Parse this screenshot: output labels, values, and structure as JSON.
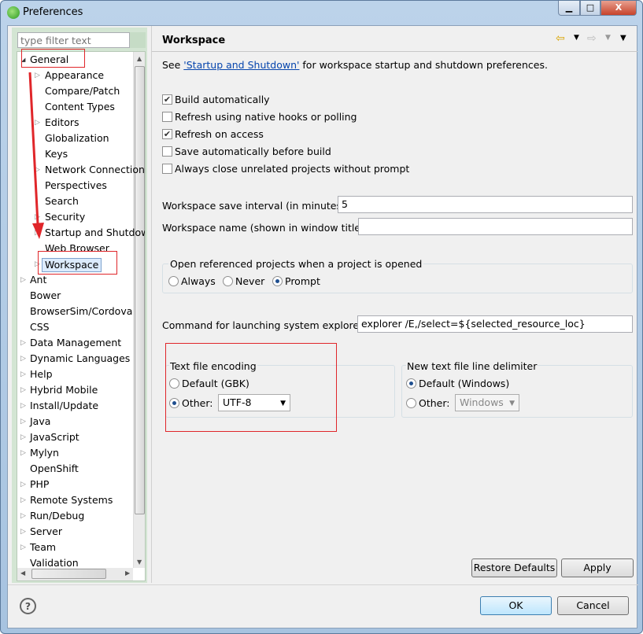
{
  "window": {
    "title": "Preferences",
    "minimize": "▁",
    "maximize": "□",
    "close": "X"
  },
  "filter": {
    "placeholder": "type filter text"
  },
  "tree": {
    "general": "General",
    "children": [
      {
        "label": "Appearance",
        "exp": true
      },
      {
        "label": "Compare/Patch"
      },
      {
        "label": "Content Types"
      },
      {
        "label": "Editors",
        "exp": true
      },
      {
        "label": "Globalization"
      },
      {
        "label": "Keys"
      },
      {
        "label": "Network Connections",
        "exp": true
      },
      {
        "label": "Perspectives"
      },
      {
        "label": "Search"
      },
      {
        "label": "Security",
        "exp": true
      },
      {
        "label": "Startup and Shutdown",
        "exp": true
      },
      {
        "label": "Web Browser"
      }
    ],
    "selected": "Workspace",
    "top": [
      {
        "label": "Ant",
        "exp": true
      },
      {
        "label": "Bower"
      },
      {
        "label": "BrowserSim/Cordova"
      },
      {
        "label": "CSS"
      },
      {
        "label": "Data Management",
        "exp": true
      },
      {
        "label": "Dynamic Languages",
        "exp": true
      },
      {
        "label": "Help",
        "exp": true
      },
      {
        "label": "Hybrid Mobile",
        "exp": true
      },
      {
        "label": "Install/Update",
        "exp": true
      },
      {
        "label": "Java",
        "exp": true
      },
      {
        "label": "JavaScript",
        "exp": true
      },
      {
        "label": "Mylyn",
        "exp": true
      },
      {
        "label": "OpenShift"
      },
      {
        "label": "PHP",
        "exp": true
      },
      {
        "label": "Remote Systems",
        "exp": true
      },
      {
        "label": "Run/Debug",
        "exp": true
      },
      {
        "label": "Server",
        "exp": true
      },
      {
        "label": "Team",
        "exp": true
      },
      {
        "label": "Validation"
      }
    ]
  },
  "page": {
    "title": "Workspace",
    "see_prefix": "See ",
    "see_link": "'Startup and Shutdown'",
    "see_suffix": " for workspace startup and shutdown preferences.",
    "checks": [
      {
        "label": "Build automatically",
        "checked": true
      },
      {
        "label": "Refresh using native hooks or polling",
        "checked": false
      },
      {
        "label": "Refresh on access",
        "checked": true
      },
      {
        "label": "Save automatically before build",
        "checked": false
      },
      {
        "label": "Always close unrelated projects without prompt",
        "checked": false
      }
    ],
    "save_interval_label": "Workspace save interval (in minutes):",
    "save_interval": "5",
    "ws_name_label": "Workspace name (shown in window title):",
    "ws_name": "",
    "open_ref": {
      "title": "Open referenced projects when a project is opened",
      "options": [
        "Always",
        "Never",
        "Prompt"
      ],
      "selected": "Prompt"
    },
    "explorer_label": "Command for launching system explorer:",
    "explorer_cmd": "explorer /E,/select=${selected_resource_loc}",
    "encoding": {
      "title": "Text file encoding",
      "default": "Default (GBK)",
      "other": "Other:",
      "value": "UTF-8",
      "selected": "Other"
    },
    "delimiter": {
      "title": "New text file line delimiter",
      "default": "Default (Windows)",
      "other": "Other:",
      "value": "Windows",
      "selected": "Default"
    },
    "restore": "Restore Defaults",
    "apply": "Apply"
  },
  "footer": {
    "ok": "OK",
    "cancel": "Cancel",
    "help": "?"
  },
  "colors": {
    "annotation": "#e0262a",
    "link": "#0645ad"
  }
}
